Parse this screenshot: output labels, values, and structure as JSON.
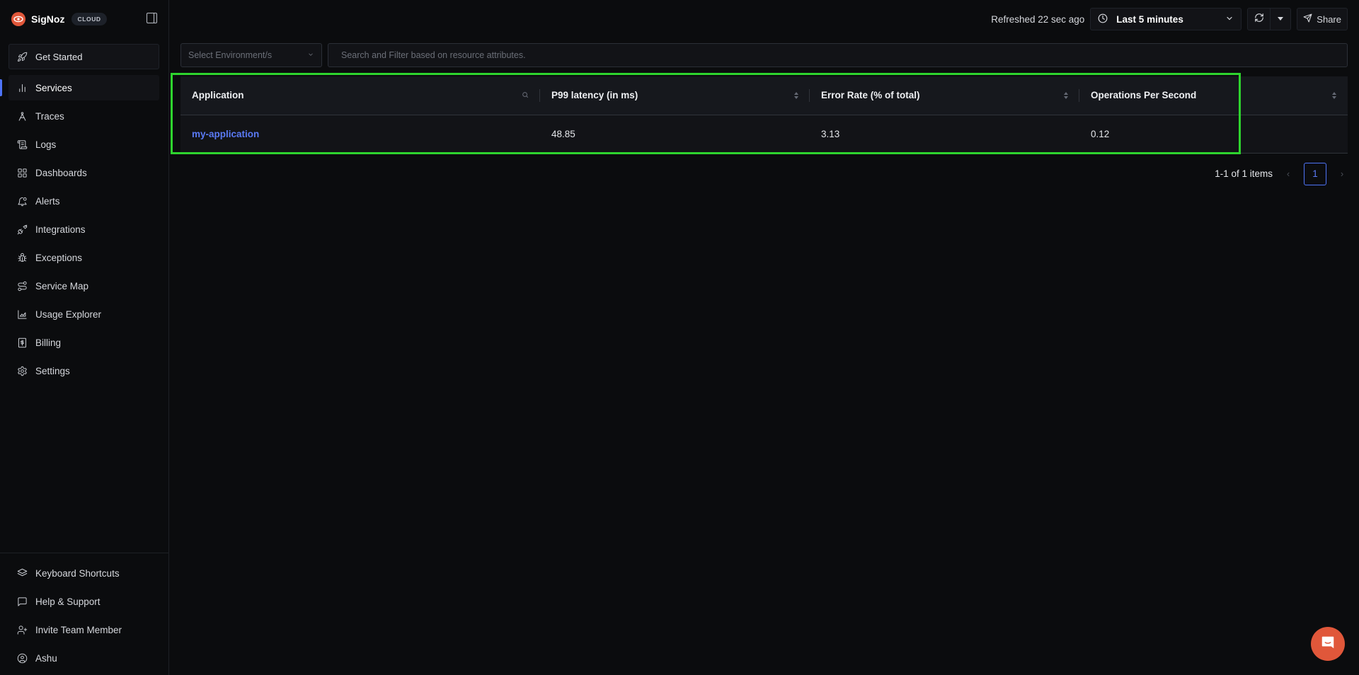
{
  "brand": {
    "name": "SigNoz",
    "badge": "CLOUD"
  },
  "sidebar": {
    "get_started": "Get Started",
    "items": [
      {
        "label": "Services",
        "icon": "bar-chart-icon",
        "active": true
      },
      {
        "label": "Traces",
        "icon": "traces-icon"
      },
      {
        "label": "Logs",
        "icon": "logs-scroll-icon"
      },
      {
        "label": "Dashboards",
        "icon": "grid-icon"
      },
      {
        "label": "Alerts",
        "icon": "bell-icon"
      },
      {
        "label": "Integrations",
        "icon": "plug-icon"
      },
      {
        "label": "Exceptions",
        "icon": "bug-icon"
      },
      {
        "label": "Service Map",
        "icon": "route-icon"
      },
      {
        "label": "Usage Explorer",
        "icon": "area-chart-icon"
      },
      {
        "label": "Billing",
        "icon": "receipt-icon"
      },
      {
        "label": "Settings",
        "icon": "gear-icon"
      }
    ],
    "bottom_items": [
      {
        "label": "Keyboard Shortcuts",
        "icon": "layers-icon"
      },
      {
        "label": "Help & Support",
        "icon": "message-square-icon"
      },
      {
        "label": "Invite Team Member",
        "icon": "user-plus-icon"
      },
      {
        "label": "Ashu",
        "icon": "user-circle-icon"
      }
    ]
  },
  "topbar": {
    "refreshed": "Refreshed 22 sec ago",
    "time_range": "Last 5 minutes",
    "share": "Share"
  },
  "filters": {
    "environment_placeholder": "Select Environment/s",
    "search_placeholder": "Search and Filter based on resource attributes."
  },
  "table": {
    "columns": [
      "Application",
      "P99 latency (in ms)",
      "Error Rate (% of total)",
      "Operations Per Second"
    ],
    "rows": [
      {
        "application": "my-application",
        "p99": "48.85",
        "error_rate": "3.13",
        "ops": "0.12"
      }
    ]
  },
  "pagination": {
    "summary": "1-1 of 1 items",
    "current_page": "1"
  },
  "colors": {
    "accent": "#4e74f8",
    "brand": "#e0573a",
    "highlight": "#2ed42e"
  }
}
